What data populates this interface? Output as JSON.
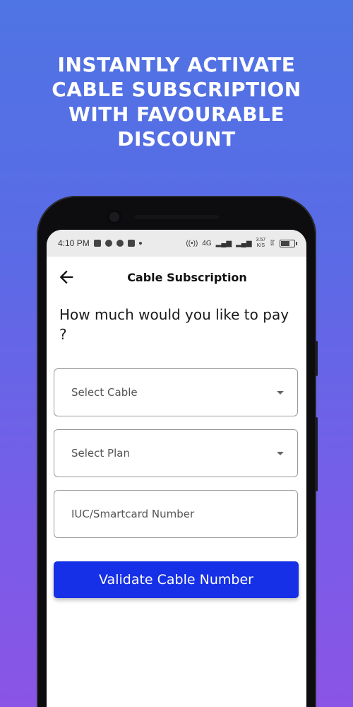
{
  "headline": {
    "lines": [
      "INSTANTLY ACTIVATE",
      "CABLE SUBSCRIPTION",
      "WITH FAVOURABLE",
      "DISCOUNT"
    ]
  },
  "statusbar": {
    "time": "4:10 PM",
    "network_label": "4G",
    "speed_value": "3.57",
    "speed_unit": "K/S"
  },
  "appbar": {
    "title": "Cable Subscription",
    "back_icon": "arrow-left-icon"
  },
  "main": {
    "question": "How much would you like to pay ?",
    "select_cable_placeholder": "Select Cable",
    "select_plan_placeholder": "Select Plan",
    "iuc_placeholder": "IUC/Smartcard Number",
    "iuc_value": "",
    "validate_label": "Validate Cable Number"
  },
  "colors": {
    "background_top": "#4f74e3",
    "background_bottom": "#8a54e6",
    "button": "#1530e6"
  }
}
